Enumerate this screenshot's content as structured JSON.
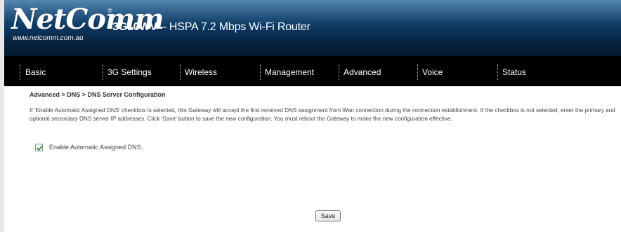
{
  "header": {
    "logo_text": "NetComm",
    "logo_mark": "®",
    "logo_url": "www.netcomm.com.au",
    "product_model": "3G10WV",
    "product_desc": " – HSPA 7.2 Mbps Wi-Fi Router"
  },
  "nav": {
    "items": [
      {
        "label": "Basic"
      },
      {
        "label": "3G Settings"
      },
      {
        "label": "Wireless"
      },
      {
        "label": "Management"
      },
      {
        "label": "Advanced"
      },
      {
        "label": "Voice"
      },
      {
        "label": "Status"
      }
    ]
  },
  "page": {
    "breadcrumb": "Advanced > DNS > DNS Server Configuration",
    "description": "If 'Enable Automatic Assigned DNS' checkbox is selected, this Gateway will accept the first received DNS assignment from Wan connection during the connection establishment. If the checkbox is not selected, enter the primary and optional secondary DNS server IP addresses. Click 'Save' button to save the new configuration. You must reboot the Gateway to make the new configuration effective.",
    "auto_dns_label": "Enable Automatic Assigned DNS",
    "auto_dns_checked": true,
    "save_label": "Save"
  },
  "colors": {
    "header_top": "#1e5482",
    "header_bottom": "#061a2e",
    "nav_background": "#000000",
    "checkmark": "#2e8b2e"
  }
}
